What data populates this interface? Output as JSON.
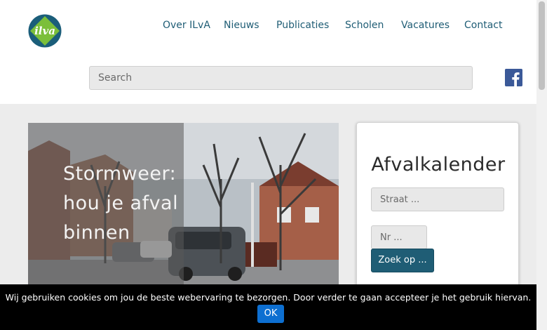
{
  "header": {
    "logo_text": "ilva",
    "nav": [
      "Over ILvA",
      "Nieuws",
      "Publicaties",
      "Scholen",
      "Vacatures",
      "Contact"
    ],
    "search_placeholder": "Search",
    "social_icon": "facebook-icon"
  },
  "hero": {
    "title": "Stormweer: hou je afval binnen"
  },
  "widget": {
    "title": "Afvalkalender",
    "street_placeholder": "Straat ...",
    "nr_placeholder": "Nr ...",
    "button_label": "Zoek op ..."
  },
  "cookie": {
    "message": "Wij gebruiken cookies om jou de beste webervaring te bezorgen. Door verder te gaan accepteer je het gebruik hiervan.",
    "ok_label": "OK"
  },
  "colors": {
    "brand": "#1f5d75",
    "logo_green": "#7bbf3a",
    "logo_blue": "#1b5e7a",
    "facebook": "#3b5998",
    "cookie_button": "#0d6fd1"
  }
}
